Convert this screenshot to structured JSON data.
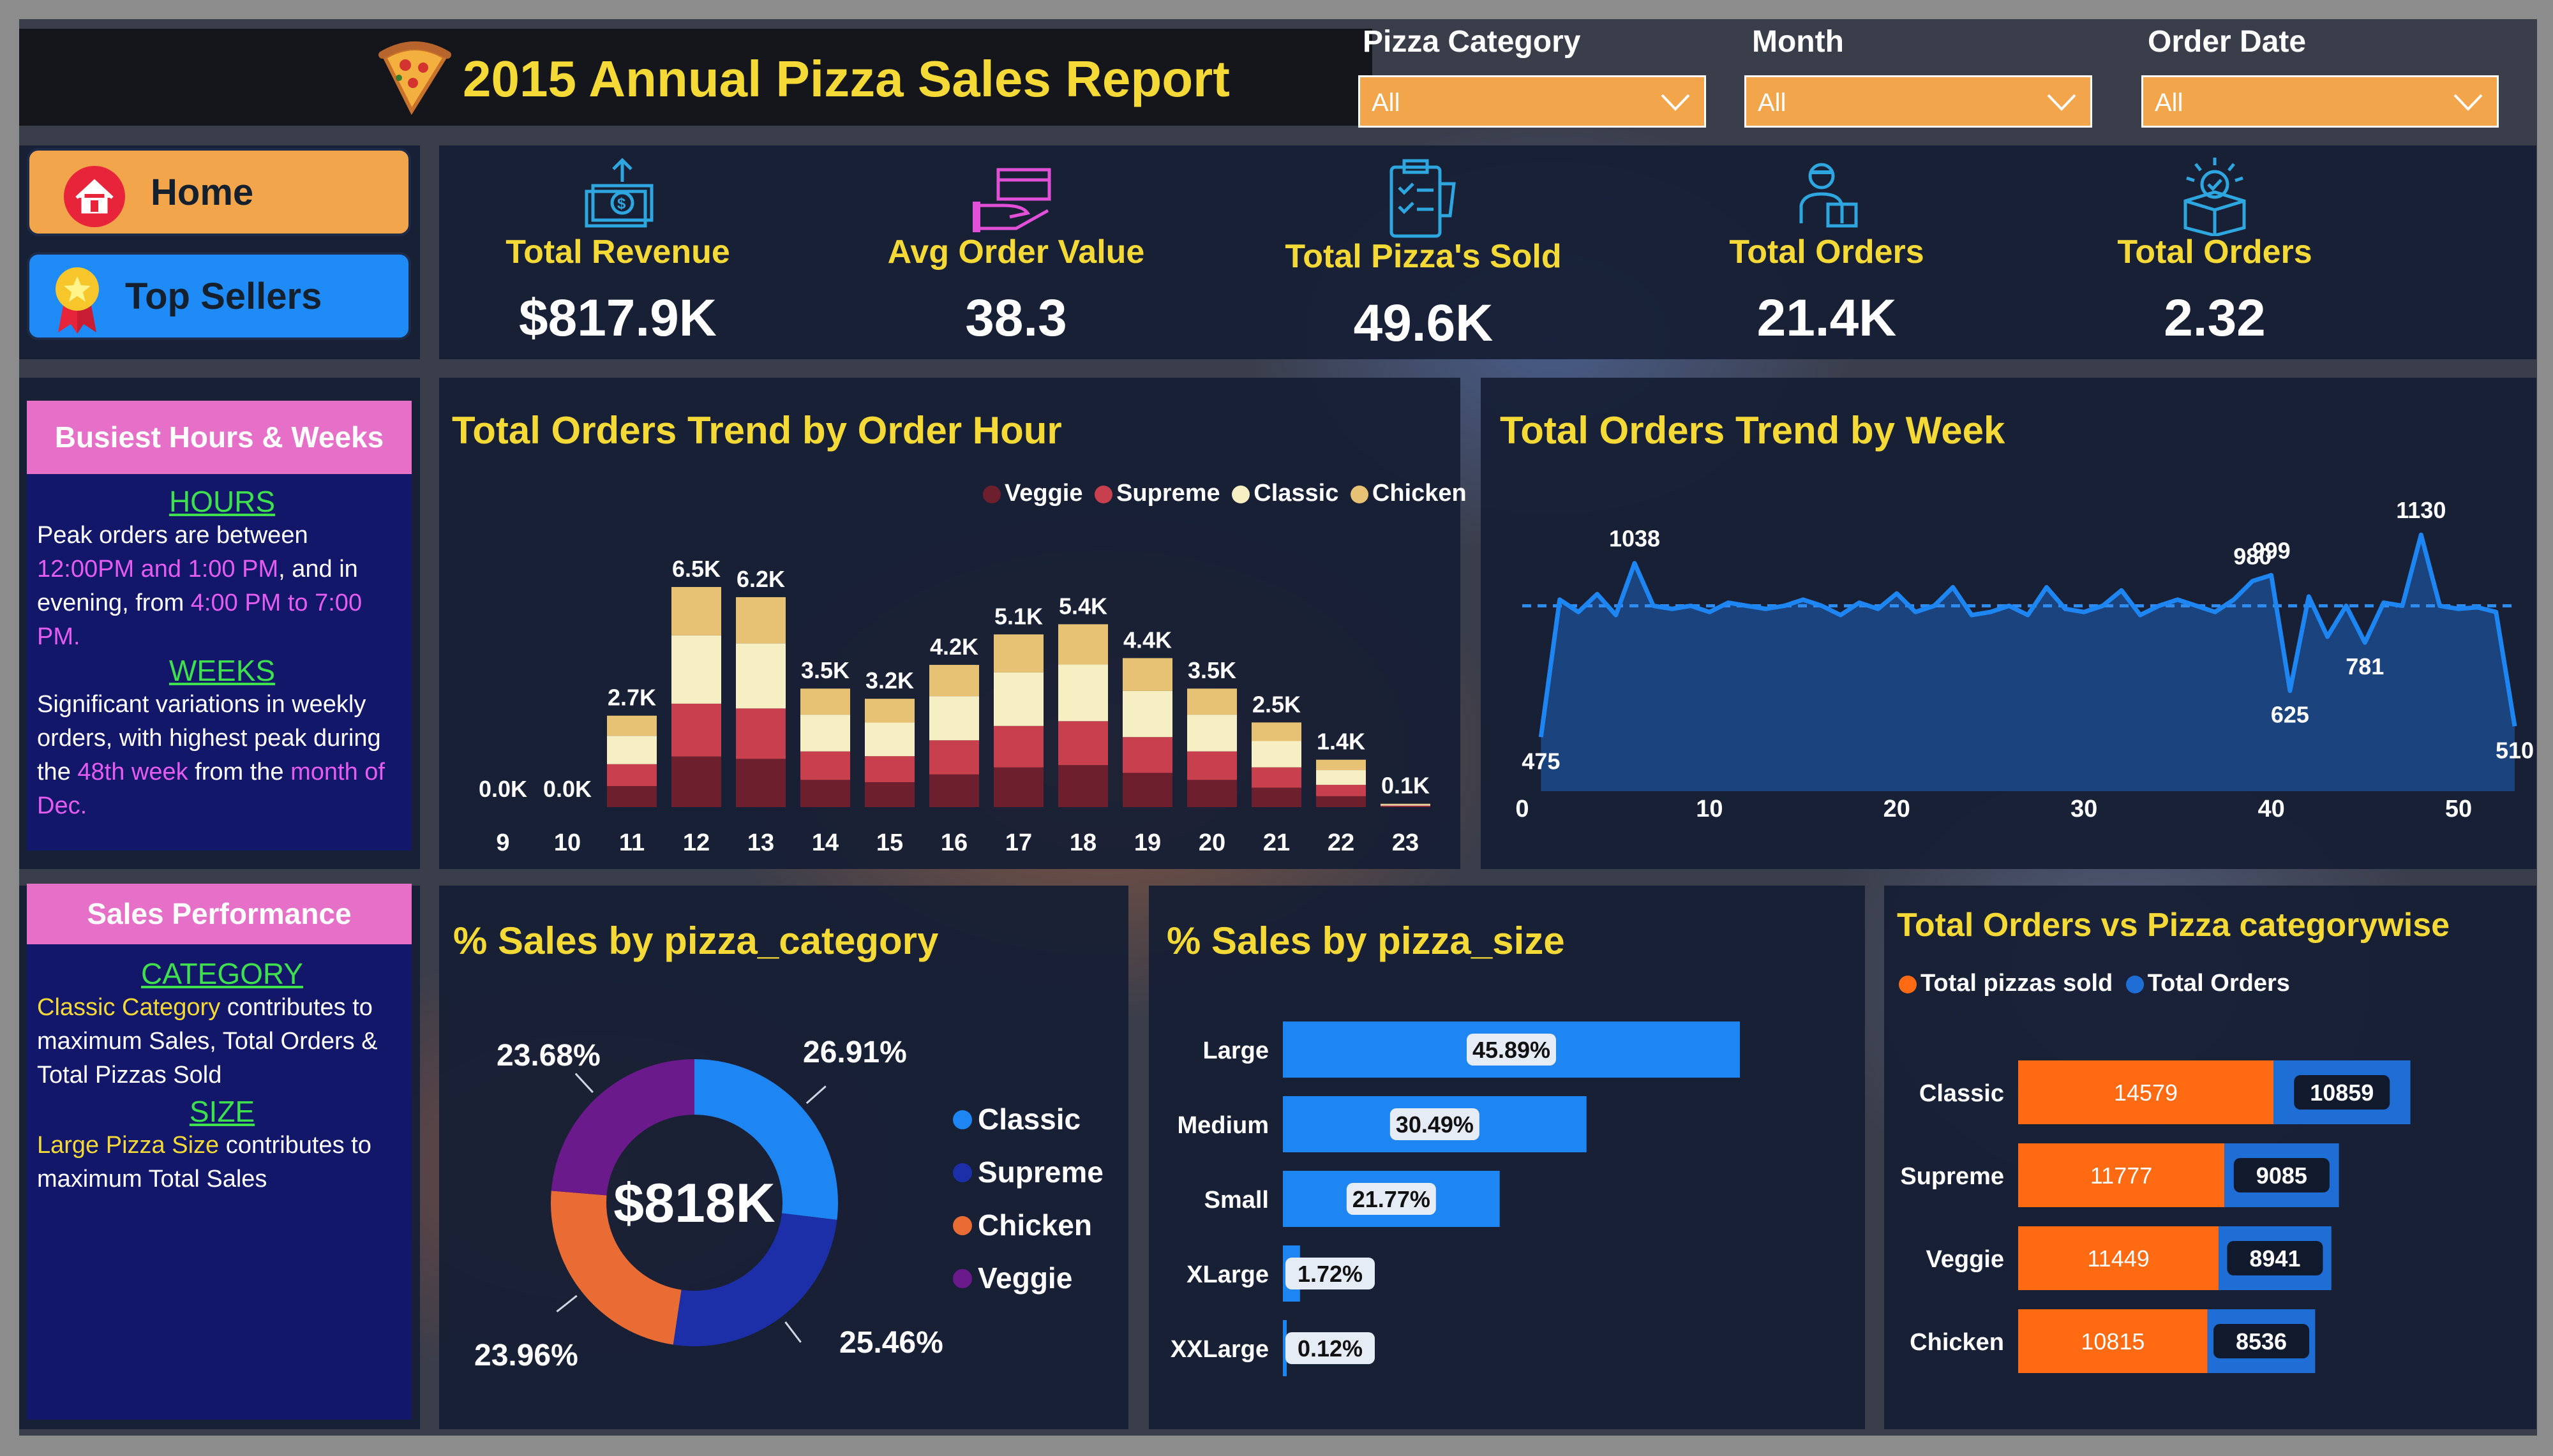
{
  "report_title": "2015 Annual Pizza Sales Report",
  "filters": [
    {
      "label": "Pizza Category",
      "value": "All"
    },
    {
      "label": "Month",
      "value": "All"
    },
    {
      "label": "Order Date",
      "value": "All"
    }
  ],
  "nav": {
    "home": "Home",
    "top_sellers": "Top Sellers"
  },
  "kpis": [
    {
      "title": "Total Revenue",
      "value": "$817.9K",
      "icon": "money-icon"
    },
    {
      "title": "Avg Order Value",
      "value": "38.3",
      "icon": "hand-money-icon"
    },
    {
      "title": "Total Pizza's Sold",
      "value": "49.6K",
      "icon": "clipboard-icon"
    },
    {
      "title": "Total Orders",
      "value": "21.4K",
      "icon": "delivery-icon"
    },
    {
      "title": "Total Orders",
      "value": "2.32",
      "icon": "box-check-icon"
    }
  ],
  "busiest": {
    "heading": "Busiest Hours & Weeks",
    "hours_head": "HOURS",
    "hours_p1": "Peak orders are between ",
    "hours_h1": "12:00PM and 1:00 PM",
    "hours_p2": ", and in evening, from ",
    "hours_h2": "4:00 PM to 7:00 PM.",
    "weeks_head": "WEEKS",
    "weeks_p1": "Significant variations in weekly orders, with highest peak during the ",
    "weeks_h1": "48th week",
    "weeks_p2": " from the ",
    "weeks_h2": "month of Dec."
  },
  "sales_perf": {
    "heading": "Sales Performance",
    "cat_head": "CATEGORY",
    "cat_h": "Classic Category",
    "cat_p": " contributes to maximum Sales, Total Orders & Total Pizzas Sold",
    "size_head": "SIZE",
    "size_h": "Large Pizza Size",
    "size_p": " contributes to maximum Total Sales"
  },
  "colors": {
    "veggie": "#6e1f2e",
    "supreme": "#c8404d",
    "classic": "#f7efc4",
    "chicken": "#e7c274",
    "pie_classic": "#1d86f2",
    "pie_supreme": "#1c2fa8",
    "pie_chicken": "#ea6c35",
    "pie_veggie": "#6a1a8a",
    "accent_yellow": "#f5d936",
    "orange": "#ff6a13",
    "blue": "#1e6ed6"
  },
  "chart_data": [
    {
      "type": "bar",
      "title": "Total Orders Trend by Order Hour",
      "categories": [
        "9",
        "10",
        "11",
        "12",
        "13",
        "14",
        "15",
        "16",
        "17",
        "18",
        "19",
        "20",
        "21",
        "22",
        "23"
      ],
      "totals_labels": [
        "0.0K",
        "0.0K",
        "2.7K",
        "6.5K",
        "6.2K",
        "3.5K",
        "3.2K",
        "4.2K",
        "5.1K",
        "5.4K",
        "4.4K",
        "3.5K",
        "2.5K",
        "1.4K",
        "0.1K"
      ],
      "totals": [
        0.0,
        0.0,
        2.7,
        6.5,
        6.2,
        3.5,
        3.2,
        4.2,
        5.1,
        5.4,
        4.4,
        3.5,
        2.5,
        1.4,
        0.1
      ],
      "stack_order": [
        "Veggie",
        "Supreme",
        "Classic",
        "Chicken"
      ],
      "share": [
        0.23,
        0.24,
        0.31,
        0.22
      ],
      "legend": [
        "Veggie",
        "Supreme",
        "Classic",
        "Chicken"
      ]
    },
    {
      "type": "line",
      "title": "Total Orders Trend by Week",
      "x": [
        1,
        2,
        3,
        4,
        5,
        6,
        7,
        8,
        9,
        10,
        11,
        12,
        13,
        14,
        15,
        16,
        17,
        18,
        19,
        20,
        21,
        22,
        23,
        24,
        25,
        26,
        27,
        28,
        29,
        30,
        31,
        32,
        33,
        34,
        35,
        36,
        37,
        38,
        39,
        40,
        41,
        42,
        43,
        44,
        45,
        46,
        47,
        48,
        49,
        50,
        51,
        52,
        53
      ],
      "y": [
        475,
        920,
        880,
        938,
        870,
        1038,
        900,
        890,
        900,
        880,
        910,
        900,
        890,
        900,
        920,
        900,
        870,
        910,
        890,
        940,
        880,
        900,
        960,
        870,
        880,
        900,
        870,
        960,
        890,
        880,
        900,
        950,
        870,
        900,
        920,
        900,
        880,
        920,
        980,
        999,
        625,
        930,
        800,
        900,
        781,
        910,
        900,
        1130,
        900,
        890,
        895,
        880,
        510
      ],
      "point_labels": [
        {
          "x": 1,
          "y": 475,
          "text": "475"
        },
        {
          "x": 6,
          "y": 1038,
          "text": "1038"
        },
        {
          "x": 39,
          "y": 980,
          "text": "980"
        },
        {
          "x": 40,
          "y": 999,
          "text": "999"
        },
        {
          "x": 41,
          "y": 625,
          "text": "625"
        },
        {
          "x": 45,
          "y": 781,
          "text": "781"
        },
        {
          "x": 48,
          "y": 1130,
          "text": "1130"
        },
        {
          "x": 53,
          "y": 510,
          "text": "510"
        }
      ],
      "xticks": [
        0,
        10,
        20,
        30,
        40,
        50
      ],
      "xlim": [
        0,
        53
      ],
      "ylim": [
        300,
        1250
      ],
      "avg_line": 900
    },
    {
      "type": "pie",
      "title": "% Sales by pizza_category",
      "center_label": "$818K",
      "labels": [
        "Classic",
        "Supreme",
        "Chicken",
        "Veggie"
      ],
      "values": [
        26.91,
        25.46,
        23.96,
        23.68
      ],
      "value_labels": [
        "26.91%",
        "25.46%",
        "23.96%",
        "23.68%"
      ]
    },
    {
      "type": "bar",
      "title": "% Sales by pizza_size",
      "categories": [
        "Large",
        "Medium",
        "Small",
        "XLarge",
        "XXLarge"
      ],
      "values": [
        45.89,
        30.49,
        21.77,
        1.72,
        0.12
      ],
      "value_labels": [
        "45.89%",
        "30.49%",
        "21.77%",
        "1.72%",
        "0.12%"
      ]
    },
    {
      "type": "bar",
      "title": "Total Orders vs Pizza categorywise",
      "categories": [
        "Classic",
        "Supreme",
        "Veggie",
        "Chicken"
      ],
      "series": [
        {
          "name": "Total pizzas sold",
          "values": [
            14579,
            11777,
            11449,
            10815
          ]
        },
        {
          "name": "Total Orders",
          "values": [
            10859,
            9085,
            8941,
            8536
          ]
        }
      ]
    }
  ]
}
